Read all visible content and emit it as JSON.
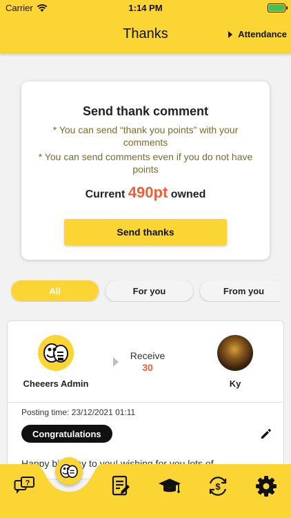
{
  "status_bar": {
    "carrier": "Carrier",
    "time": "1:14 PM"
  },
  "header": {
    "title": "Thanks",
    "attendance_label": "Attendance"
  },
  "send_card": {
    "title": "Send thank comment",
    "note1": "* You can send “thank you points” with your comments",
    "note2": "* You can send comments even if you do not have points",
    "current_prefix": "Current",
    "points_value": "490pt",
    "current_suffix": "owned",
    "button_label": "Send thanks"
  },
  "filters": [
    {
      "label": "All",
      "active": true
    },
    {
      "label": "For you",
      "active": false
    },
    {
      "label": "From you",
      "active": false
    }
  ],
  "post": {
    "sender_name": "Cheeers Admin",
    "receive_label": "Receive",
    "receive_value": "30",
    "receiver_name": "Ky",
    "posting_time": "Posting time: 23/12/2021 01:11",
    "badge_label": "Congratulations",
    "message": "Happy birthday to you! wishing for you lots of"
  },
  "bottom_nav": {
    "items": [
      "question-chat-icon",
      "cheeers-logo-icon",
      "document-edit-icon",
      "graduation-cap-icon",
      "currency-exchange-icon",
      "settings-gear-icon"
    ]
  },
  "colors": {
    "accent": "#fbd534",
    "points": "#e8613a",
    "badge": "#111111"
  }
}
